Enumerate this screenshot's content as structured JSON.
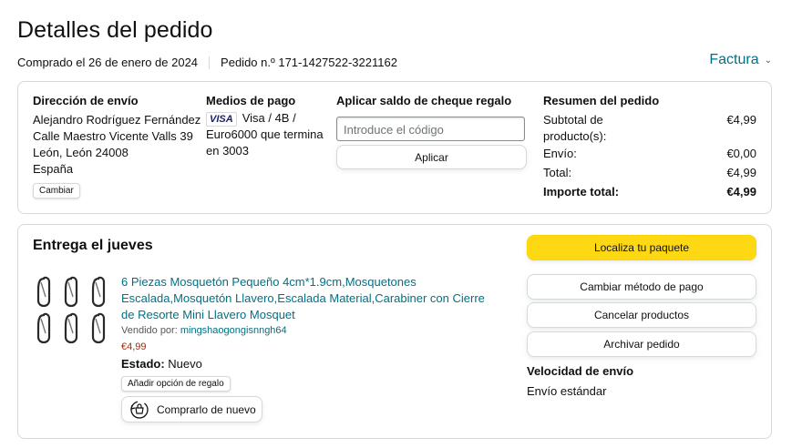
{
  "header": {
    "title": "Detalles del pedido",
    "ordered_on": "Comprado el 26 de enero de 2024",
    "order_number": "Pedido n.º 171-1427522-3221162",
    "invoice_label": "Factura"
  },
  "shipping": {
    "heading": "Dirección de envío",
    "lines": [
      "Alejandro Rodríguez Fernández",
      "Calle Maestro Vicente Valls 39",
      "León, León 24008",
      "España"
    ],
    "change_label": "Cambiar"
  },
  "payment": {
    "heading": "Medios de pago",
    "card_brand": "VISA",
    "line1": "Visa / 4B /",
    "line2": "Euro6000  que termina",
    "line3": "en 3003"
  },
  "gift_card": {
    "heading": "Aplicar saldo de cheque regalo",
    "placeholder": "Introduce el código",
    "apply_label": "Aplicar"
  },
  "summary": {
    "heading": "Resumen del pedido",
    "subtotal_label": "Subtotal de producto(s):",
    "subtotal_value": "€4,99",
    "shipping_label": "Envío:",
    "shipping_value": "€0,00",
    "total_label": "Total:",
    "total_value": "€4,99",
    "grand_total_label": "Importe total:",
    "grand_total_value": "€4,99"
  },
  "delivery": {
    "heading": "Entrega el jueves",
    "product": {
      "title": "6 Piezas Mosquetón Pequeño 4cm*1.9cm,Mosquetones Escalada,Mosquetón Llavero,Escalada Material,Carabiner con Cierre de Resorte Mini Llavero Mosquet",
      "seller_prefix": "Vendido por:",
      "seller_name": "mingshaogongisnngh64",
      "price": "€4,99",
      "status_label": "Estado:",
      "status_value": "Nuevo",
      "gift_option_label": "Añadir opción de regalo",
      "rebuy_label": "Comprarlo de nuevo",
      "image_icon": "carabiner-icon"
    },
    "actions": {
      "track": "Localiza tu paquete",
      "change_payment": "Cambiar método de pago",
      "cancel": "Cancelar productos",
      "archive": "Archivar pedido"
    },
    "speed_heading": "Velocidad de envío",
    "speed_value": "Envío estándar"
  },
  "colors": {
    "link": "#007185",
    "primary_button": "#ffd814",
    "price": "#b12704",
    "border": "#d5d9d9"
  }
}
